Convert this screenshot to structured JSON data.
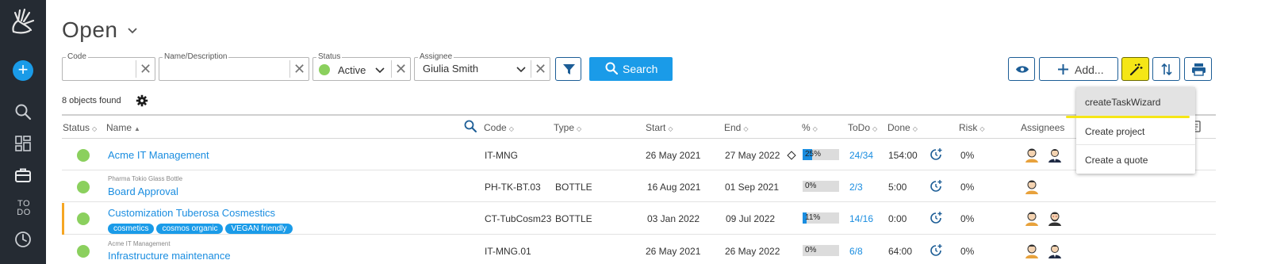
{
  "header": {
    "title": "Open"
  },
  "sidebar": {
    "todo_label_top": "TO",
    "todo_label_bottom": "DO",
    "add_symbol": "+"
  },
  "filters": {
    "code": {
      "label": "Code",
      "value": ""
    },
    "name": {
      "label": "Name/Description",
      "value": ""
    },
    "status": {
      "label": "Status",
      "value": "Active"
    },
    "assignee": {
      "label": "Assignee",
      "value": "Giulia Smith"
    },
    "search_label": "Search",
    "clear_symbol": "✕"
  },
  "toolbar": {
    "add_label": "Add..."
  },
  "results": {
    "count_text": "8 objects found"
  },
  "table": {
    "headers": {
      "status": "Status",
      "name": "Name",
      "code": "Code",
      "type": "Type",
      "start": "Start",
      "end": "End",
      "percent": "%",
      "todo": "ToDo",
      "done": "Done",
      "risk": "Risk",
      "assignees": "Assignees"
    },
    "rows": [
      {
        "parent": "",
        "name": "Acme IT Management",
        "tags": [],
        "code": "IT-MNG",
        "type": "",
        "start": "26 May 2021",
        "end": "27 May 2022",
        "milestone": true,
        "percent_label": "25%",
        "percent": 0.25,
        "todo": "24/34",
        "done": "154:00",
        "risk": "0%",
        "assignee_count": 2,
        "flagged": false
      },
      {
        "parent": "Pharma Tokio Glass Bottle",
        "name": "Board Approval",
        "tags": [],
        "code": "PH-TK-BT.03",
        "type": "BOTTLE",
        "start": "16 Aug 2021",
        "end": "01 Sep 2021",
        "milestone": false,
        "percent_label": "0%",
        "percent": 0,
        "todo": "2/3",
        "done": "5:00",
        "risk": "0%",
        "assignee_count": 1,
        "flagged": false
      },
      {
        "parent": "",
        "name": "Customization Tuberosa Cosmestics",
        "tags": [
          "cosmetics",
          "cosmos organic",
          "VEGAN friendly"
        ],
        "code": "CT-TubCosm23",
        "type": "BOTTLE",
        "start": "03 Jan 2022",
        "end": "09 Jul 2022",
        "milestone": false,
        "percent_label": "11%",
        "percent": 0.11,
        "todo": "14/16",
        "done": "0:00",
        "risk": "0%",
        "assignee_count": 2,
        "flagged": true
      },
      {
        "parent": "Acme IT Management",
        "name": "Infrastructure maintenance",
        "tags": [],
        "code": "IT-MNG.01",
        "type": "",
        "start": "26 May 2021",
        "end": "26 May 2022",
        "milestone": false,
        "percent_label": "0%",
        "percent": 0,
        "todo": "6/8",
        "done": "64:00",
        "risk": "0%",
        "assignee_count": 2,
        "flagged": false
      }
    ]
  },
  "menu": {
    "items": [
      {
        "label": "createTaskWizard"
      },
      {
        "label": "Create project"
      },
      {
        "label": "Create a quote"
      }
    ]
  },
  "colors": {
    "accent": "#1a9be8",
    "sidebar": "#252b33",
    "status_green": "#8bd05e",
    "highlight": "#f5e616",
    "flag": "#f5a623"
  },
  "icons": [
    "logo-hand-icon",
    "add-icon",
    "search-icon",
    "dashboard-icon",
    "briefcase-icon",
    "todo-icon",
    "clock-icon",
    "chevron-down-icon",
    "funnel-icon",
    "eye-icon",
    "plus-icon",
    "magic-wand-icon",
    "sort-icon",
    "print-icon",
    "gear-icon",
    "clock-plus-icon",
    "avatar-icon"
  ]
}
